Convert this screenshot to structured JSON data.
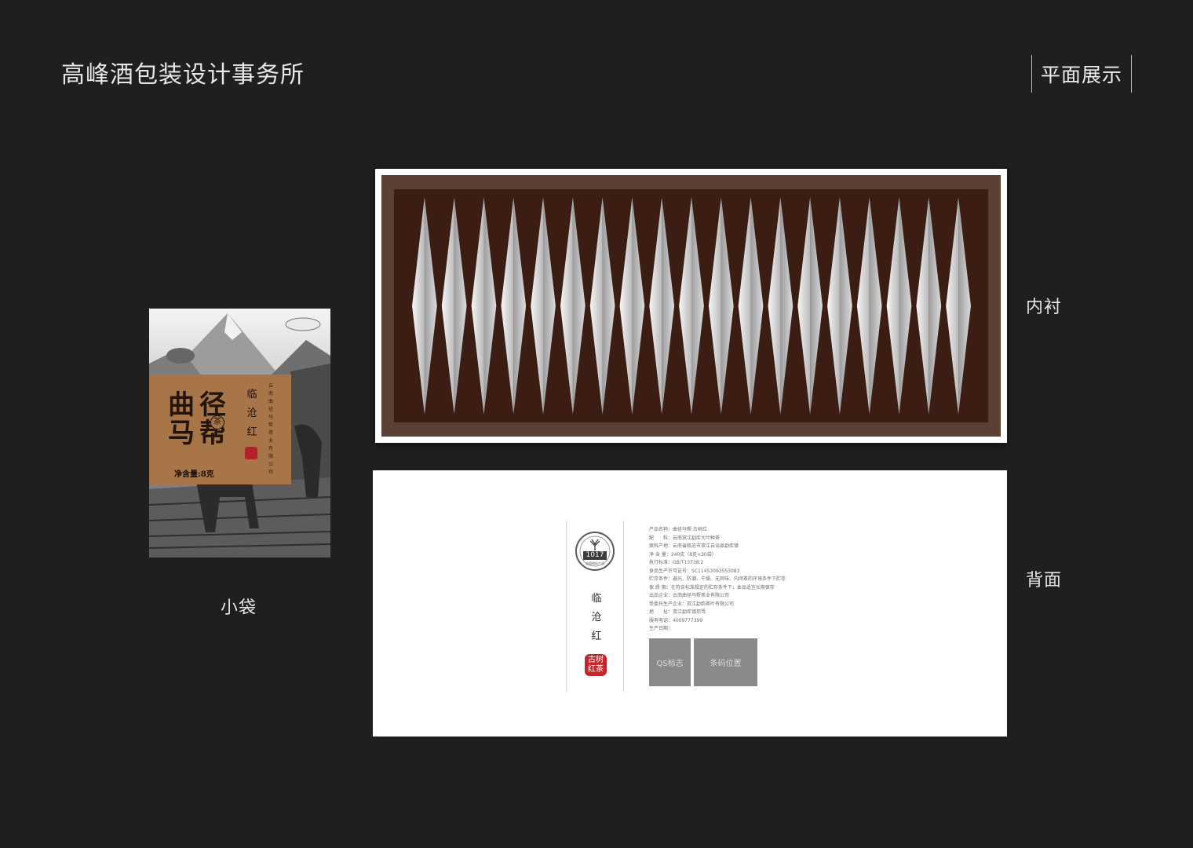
{
  "header": {
    "studio_title": "高峰酒包装设计事务所",
    "section_tag": "平面展示"
  },
  "labels": {
    "pouch": "小袋",
    "liner": "内衬",
    "back": "背面"
  },
  "pouch": {
    "brand_chars": [
      "曲",
      "径",
      "马",
      "帮"
    ],
    "brand_mini": "茶",
    "product_name": "临沧红",
    "company_name": "云南曲径马帮茶业有限公司",
    "seal_text": "古树红茶",
    "net_weight": "净含量:8克"
  },
  "back": {
    "badge_number": "1017",
    "badge_caption": "全国地标产品",
    "product_name": "临沧红",
    "seal_text": "古树红茶",
    "spec_lines": [
      "产品名称：曲径马帮·古树红",
      "配　　料：云南双江勐库大叶种茶",
      "原料产地：云南省临沧市双江自治县勐库镇",
      "净 含 量：240克（8克×30袋）",
      "执行标准：GB/T13738.2",
      "食品生产许可证号：SC11453092553083",
      "贮存条件：避光、防潮、干燥、无异味、内闭茶的环境条件下贮存",
      "保 质 期：在符合标准规定的贮存条件下，本品适宜长期保存",
      "出品企业：云南曲径马帮茶业有限公司",
      "受委托生产企业：双江勐韵茶叶有限公司",
      "地　　址：双江勐库镇邦骂",
      "服务电话：4009777399",
      "生产日期："
    ],
    "qs_label": "QS标志",
    "barcode_label": "条码位置"
  }
}
